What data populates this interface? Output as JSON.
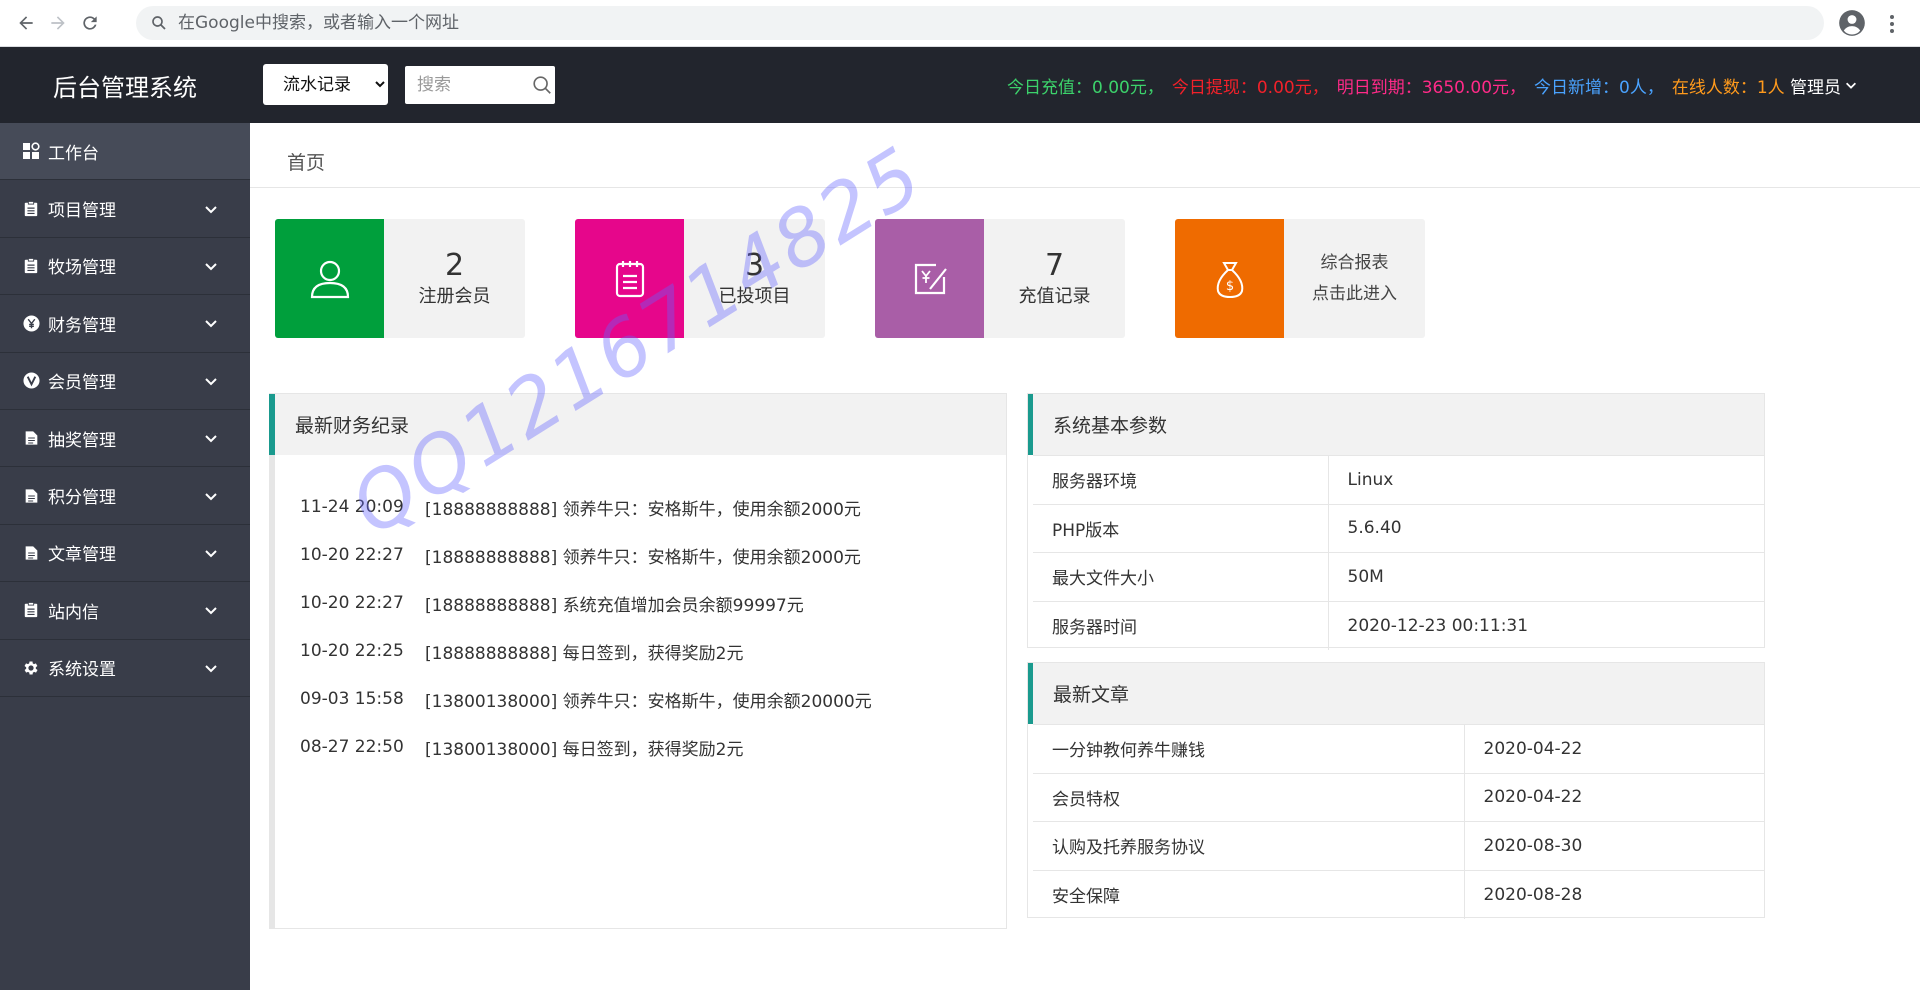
{
  "browser": {
    "omnibox_placeholder": "在Google中搜索，或者输入一个网址"
  },
  "header": {
    "app_title": "后台管理系统",
    "record_select": {
      "selected": "流水记录",
      "options": [
        "流水记录"
      ]
    },
    "search_placeholder": "搜索",
    "stats": [
      {
        "label": "今日充值：",
        "value": "0.00元，",
        "color": "#3cd26b"
      },
      {
        "label": "今日提现：",
        "value": "0.00元，",
        "color": "#f2212a"
      },
      {
        "label": "明日到期：",
        "value": "3650.00元，",
        "color": "#ff2a88"
      },
      {
        "label": "今日新增：",
        "value": "0人，",
        "color": "#4aa3ff"
      },
      {
        "label": "在线人数：",
        "value": "1人",
        "color": "#ff9a1c"
      }
    ],
    "admin_label": "管理员"
  },
  "sidebar": {
    "items": [
      {
        "label": "工作台",
        "icon": "dashboard-icon",
        "active": true
      },
      {
        "label": "项目管理",
        "icon": "clipboard-icon"
      },
      {
        "label": "牧场管理",
        "icon": "clipboard-icon"
      },
      {
        "label": "财务管理",
        "icon": "yen-icon"
      },
      {
        "label": "会员管理",
        "icon": "vip-icon"
      },
      {
        "label": "抽奖管理",
        "icon": "document-icon"
      },
      {
        "label": "积分管理",
        "icon": "document-icon"
      },
      {
        "label": "文章管理",
        "icon": "document-icon"
      },
      {
        "label": "站内信",
        "icon": "clipboard-icon"
      },
      {
        "label": "系统设置",
        "icon": "gear-icon"
      }
    ]
  },
  "breadcrumb": "首页",
  "cards": [
    {
      "number": "2",
      "label": "注册会员",
      "color": "#009f3c",
      "icon": "user-icon"
    },
    {
      "number": "3",
      "label": "已投项目",
      "color": "#e6068b",
      "icon": "notepad-icon"
    },
    {
      "number": "7",
      "label": "充值记录",
      "color": "#a95ea7",
      "icon": "recharge-icon"
    },
    {
      "line1": "综合报表",
      "line2": "点击此进入",
      "color": "#ef6b00",
      "icon": "money-bag-icon"
    }
  ],
  "finance": {
    "title": "最新财务纪录",
    "rows": [
      {
        "date": "11-24 20:09",
        "text": "[18888888888] 领养牛只：安格斯牛，使用余额2000元"
      },
      {
        "date": "10-20 22:27",
        "text": "[18888888888] 领养牛只：安格斯牛，使用余额2000元"
      },
      {
        "date": "10-20 22:27",
        "text": "[18888888888] 系统充值增加会员余额99997元"
      },
      {
        "date": "10-20 22:25",
        "text": "[18888888888] 每日签到，获得奖励2元"
      },
      {
        "date": "09-03 15:58",
        "text": "[13800138000] 领养牛只：安格斯牛，使用余额20000元"
      },
      {
        "date": "08-27 22:50",
        "text": "[13800138000] 每日签到，获得奖励2元"
      }
    ]
  },
  "system": {
    "title": "系统基本参数",
    "rows": [
      {
        "key": "服务器环境",
        "value": "Linux"
      },
      {
        "key": "PHP版本",
        "value": "5.6.40"
      },
      {
        "key": "最大文件大小",
        "value": "50M"
      },
      {
        "key": "服务器时间",
        "value": "2020-12-23 00:11:31"
      }
    ]
  },
  "articles": {
    "title": "最新文章",
    "rows": [
      {
        "title": "一分钟教何养牛赚钱",
        "date": "2020-04-22"
      },
      {
        "title": "会员特权",
        "date": "2020-04-22"
      },
      {
        "title": "认购及托养服务协议",
        "date": "2020-08-30"
      },
      {
        "title": "安全保障",
        "date": "2020-08-28"
      }
    ]
  },
  "watermark": "QQ1216714825"
}
